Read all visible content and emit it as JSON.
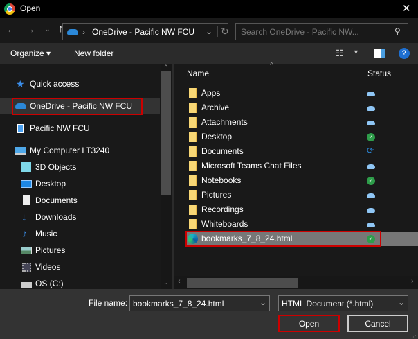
{
  "window": {
    "title": "Open",
    "close": "✕"
  },
  "address": {
    "path": "OneDrive - Pacific NW FCU",
    "separator": "›",
    "search_placeholder": "Search OneDrive - Pacific NW..."
  },
  "toolbar": {
    "organize": "Organize ▾",
    "new_folder": "New folder",
    "help": "?"
  },
  "sidebar": {
    "items": [
      {
        "label": "Quick access",
        "icon": "star-icon"
      },
      {
        "label": "OneDrive - Pacific NW FCU",
        "icon": "cloud-icon",
        "selected": true
      },
      {
        "label": "Pacific NW FCU",
        "icon": "building-icon"
      },
      {
        "label": "My Computer LT3240",
        "icon": "computer-icon"
      },
      {
        "label": "3D Objects",
        "icon": "cube-icon"
      },
      {
        "label": "Desktop",
        "icon": "desktop-icon"
      },
      {
        "label": "Documents",
        "icon": "document-icon"
      },
      {
        "label": "Downloads",
        "icon": "download-icon"
      },
      {
        "label": "Music",
        "icon": "music-icon"
      },
      {
        "label": "Pictures",
        "icon": "picture-icon"
      },
      {
        "label": "Videos",
        "icon": "video-icon"
      },
      {
        "label": "OS (C:)",
        "icon": "drive-icon"
      }
    ]
  },
  "columns": {
    "name": "Name",
    "status": "Status"
  },
  "files": [
    {
      "name": "Apps",
      "status": "cloud"
    },
    {
      "name": "Archive",
      "status": "cloud"
    },
    {
      "name": "Attachments",
      "status": "cloud"
    },
    {
      "name": "Desktop",
      "status": "synced"
    },
    {
      "name": "Documents",
      "status": "syncing"
    },
    {
      "name": "Microsoft Teams Chat Files",
      "status": "cloud"
    },
    {
      "name": "Notebooks",
      "status": "synced"
    },
    {
      "name": "Pictures",
      "status": "cloud"
    },
    {
      "name": "Recordings",
      "status": "cloud"
    },
    {
      "name": "Whiteboards",
      "status": "cloud"
    },
    {
      "name": "bookmarks_7_8_24.html",
      "status": "synced",
      "selected": true
    }
  ],
  "footer": {
    "file_name_label": "File name:",
    "file_name_value": "bookmarks_7_8_24.html",
    "file_type": "HTML Document (*.html)",
    "open": "Open",
    "cancel": "Cancel"
  },
  "colors": {
    "highlight": "#cc0000",
    "accent": "#0078d4"
  }
}
